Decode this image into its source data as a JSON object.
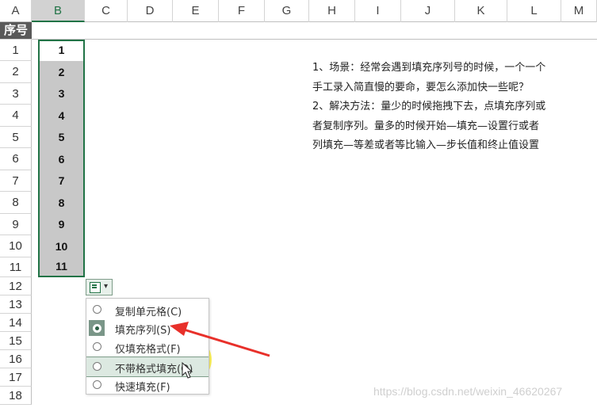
{
  "columns": [
    "A",
    "B",
    "C",
    "D",
    "E",
    "F",
    "G",
    "H",
    "I",
    "J",
    "K",
    "L",
    "M"
  ],
  "title_cell": "序号",
  "row_numbers": [
    "1",
    "2",
    "3",
    "4",
    "5",
    "6",
    "7",
    "8",
    "9",
    "10",
    "11",
    "12",
    "13",
    "14",
    "15",
    "16",
    "17",
    "18"
  ],
  "column_b_values": [
    "1",
    "2",
    "3",
    "4",
    "5",
    "6",
    "7",
    "8",
    "9",
    "10",
    "11"
  ],
  "paste_options": {
    "button_arrow": "▾",
    "items": [
      {
        "label": "复制单元格(C)",
        "checked": false
      },
      {
        "label": "填充序列(S)",
        "checked": true
      },
      {
        "label": "仅填充格式(F)",
        "checked": false
      },
      {
        "label": "不带格式填充(O)",
        "checked": false
      },
      {
        "label": "快速填充(F)",
        "checked": false
      }
    ]
  },
  "description": [
    "1、场景：经常会遇到填充序列号的时候，一个一个",
    "手工录入简直慢的要命，要怎么添加快一些呢？",
    "2、解决方法：量少的时候拖拽下去，点填充序列或",
    "者复制序列。量多的时候开始—填充—设置行或者",
    "列填充—等差或者等比输入—步长值和终止值设置"
  ],
  "watermark": "https://blog.csdn.net/weixin_46620267",
  "colors": {
    "excel_green": "#217346",
    "title_bg": "#595959",
    "arrow_red": "#e8302a",
    "highlight_yellow": "#fff028"
  }
}
